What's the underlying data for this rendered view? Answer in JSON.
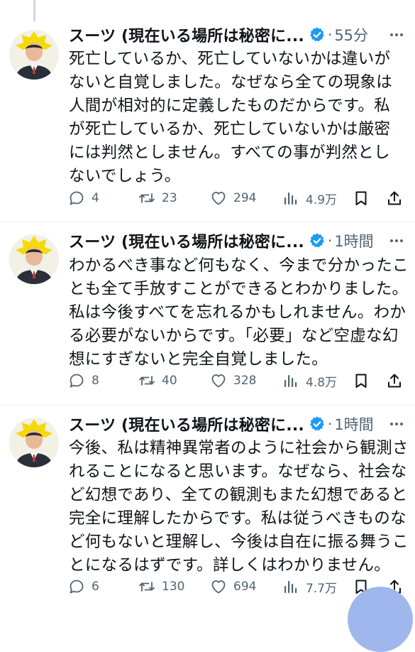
{
  "tweets": [
    {
      "author": "スーツ (現在いる場所は秘密に...",
      "time": "55分",
      "lines": [
        "死亡しているか、死亡していないかは違いが",
        "ないと自覚しました。なぜなら全ての現象は",
        "人間が相対的に定義したものだからです。私",
        "が死亡しているか、死亡していないかは厳密",
        "には判然としません。すべての事が判然とし",
        "ないでしょう。"
      ],
      "replies": "4",
      "retweets": "23",
      "likes": "294",
      "views": "4.9万"
    },
    {
      "author": "スーツ (現在いる場所は秘密に...",
      "time": "1時間",
      "lines": [
        "わかるべき事など何もなく、今まで分かったこ",
        "とも全て手放すことができるとわかりました。",
        "私は今後すべてを忘れるかもしれません。わか",
        "る必要がないからです。「必要」など空虚な幻",
        "想にすぎないと完全自覚しました。"
      ],
      "replies": "8",
      "retweets": "40",
      "likes": "328",
      "views": "4.8万"
    },
    {
      "author": "スーツ (現在いる場所は秘密に...",
      "time": "1時間",
      "lines": [
        "今後、私は精神異常者のように社会から観測さ",
        "れることになると思います。なぜなら、社会な",
        "ど幻想であり、全ての観測もまた幻想であると",
        "完全に理解したからです。私は従うべきものな",
        "ど何もないと理解し、今後は自在に振る舞うこ",
        "とになるはずです。詳しくはわかりません。"
      ],
      "replies": "6",
      "retweets": "130",
      "likes": "694",
      "views": "7.7万"
    }
  ],
  "colors": {
    "accent": "#1d9bf0",
    "muted": "#536471",
    "text": "#0f1419",
    "divider": "#eff3f4",
    "avatar_star": "#f5d90a"
  },
  "icons": [
    "reply-icon",
    "retweet-icon",
    "like-icon",
    "views-icon",
    "bookmark-icon",
    "share-icon",
    "more-icon",
    "verified-badge-icon"
  ]
}
